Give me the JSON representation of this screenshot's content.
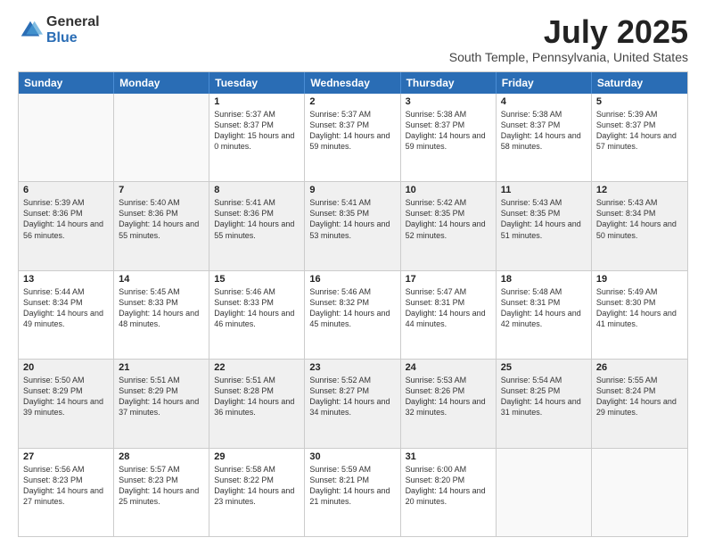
{
  "logo": {
    "general": "General",
    "blue": "Blue"
  },
  "title": "July 2025",
  "subtitle": "South Temple, Pennsylvania, United States",
  "header_days": [
    "Sunday",
    "Monday",
    "Tuesday",
    "Wednesday",
    "Thursday",
    "Friday",
    "Saturday"
  ],
  "weeks": [
    [
      {
        "day": "",
        "sunrise": "",
        "sunset": "",
        "daylight": "",
        "shaded": false,
        "empty": true
      },
      {
        "day": "",
        "sunrise": "",
        "sunset": "",
        "daylight": "",
        "shaded": false,
        "empty": true
      },
      {
        "day": "1",
        "sunrise": "Sunrise: 5:37 AM",
        "sunset": "Sunset: 8:37 PM",
        "daylight": "Daylight: 15 hours and 0 minutes.",
        "shaded": false,
        "empty": false
      },
      {
        "day": "2",
        "sunrise": "Sunrise: 5:37 AM",
        "sunset": "Sunset: 8:37 PM",
        "daylight": "Daylight: 14 hours and 59 minutes.",
        "shaded": false,
        "empty": false
      },
      {
        "day": "3",
        "sunrise": "Sunrise: 5:38 AM",
        "sunset": "Sunset: 8:37 PM",
        "daylight": "Daylight: 14 hours and 59 minutes.",
        "shaded": false,
        "empty": false
      },
      {
        "day": "4",
        "sunrise": "Sunrise: 5:38 AM",
        "sunset": "Sunset: 8:37 PM",
        "daylight": "Daylight: 14 hours and 58 minutes.",
        "shaded": false,
        "empty": false
      },
      {
        "day": "5",
        "sunrise": "Sunrise: 5:39 AM",
        "sunset": "Sunset: 8:37 PM",
        "daylight": "Daylight: 14 hours and 57 minutes.",
        "shaded": false,
        "empty": false
      }
    ],
    [
      {
        "day": "6",
        "sunrise": "Sunrise: 5:39 AM",
        "sunset": "Sunset: 8:36 PM",
        "daylight": "Daylight: 14 hours and 56 minutes.",
        "shaded": true,
        "empty": false
      },
      {
        "day": "7",
        "sunrise": "Sunrise: 5:40 AM",
        "sunset": "Sunset: 8:36 PM",
        "daylight": "Daylight: 14 hours and 55 minutes.",
        "shaded": true,
        "empty": false
      },
      {
        "day": "8",
        "sunrise": "Sunrise: 5:41 AM",
        "sunset": "Sunset: 8:36 PM",
        "daylight": "Daylight: 14 hours and 55 minutes.",
        "shaded": true,
        "empty": false
      },
      {
        "day": "9",
        "sunrise": "Sunrise: 5:41 AM",
        "sunset": "Sunset: 8:35 PM",
        "daylight": "Daylight: 14 hours and 53 minutes.",
        "shaded": true,
        "empty": false
      },
      {
        "day": "10",
        "sunrise": "Sunrise: 5:42 AM",
        "sunset": "Sunset: 8:35 PM",
        "daylight": "Daylight: 14 hours and 52 minutes.",
        "shaded": true,
        "empty": false
      },
      {
        "day": "11",
        "sunrise": "Sunrise: 5:43 AM",
        "sunset": "Sunset: 8:35 PM",
        "daylight": "Daylight: 14 hours and 51 minutes.",
        "shaded": true,
        "empty": false
      },
      {
        "day": "12",
        "sunrise": "Sunrise: 5:43 AM",
        "sunset": "Sunset: 8:34 PM",
        "daylight": "Daylight: 14 hours and 50 minutes.",
        "shaded": true,
        "empty": false
      }
    ],
    [
      {
        "day": "13",
        "sunrise": "Sunrise: 5:44 AM",
        "sunset": "Sunset: 8:34 PM",
        "daylight": "Daylight: 14 hours and 49 minutes.",
        "shaded": false,
        "empty": false
      },
      {
        "day": "14",
        "sunrise": "Sunrise: 5:45 AM",
        "sunset": "Sunset: 8:33 PM",
        "daylight": "Daylight: 14 hours and 48 minutes.",
        "shaded": false,
        "empty": false
      },
      {
        "day": "15",
        "sunrise": "Sunrise: 5:46 AM",
        "sunset": "Sunset: 8:33 PM",
        "daylight": "Daylight: 14 hours and 46 minutes.",
        "shaded": false,
        "empty": false
      },
      {
        "day": "16",
        "sunrise": "Sunrise: 5:46 AM",
        "sunset": "Sunset: 8:32 PM",
        "daylight": "Daylight: 14 hours and 45 minutes.",
        "shaded": false,
        "empty": false
      },
      {
        "day": "17",
        "sunrise": "Sunrise: 5:47 AM",
        "sunset": "Sunset: 8:31 PM",
        "daylight": "Daylight: 14 hours and 44 minutes.",
        "shaded": false,
        "empty": false
      },
      {
        "day": "18",
        "sunrise": "Sunrise: 5:48 AM",
        "sunset": "Sunset: 8:31 PM",
        "daylight": "Daylight: 14 hours and 42 minutes.",
        "shaded": false,
        "empty": false
      },
      {
        "day": "19",
        "sunrise": "Sunrise: 5:49 AM",
        "sunset": "Sunset: 8:30 PM",
        "daylight": "Daylight: 14 hours and 41 minutes.",
        "shaded": false,
        "empty": false
      }
    ],
    [
      {
        "day": "20",
        "sunrise": "Sunrise: 5:50 AM",
        "sunset": "Sunset: 8:29 PM",
        "daylight": "Daylight: 14 hours and 39 minutes.",
        "shaded": true,
        "empty": false
      },
      {
        "day": "21",
        "sunrise": "Sunrise: 5:51 AM",
        "sunset": "Sunset: 8:29 PM",
        "daylight": "Daylight: 14 hours and 37 minutes.",
        "shaded": true,
        "empty": false
      },
      {
        "day": "22",
        "sunrise": "Sunrise: 5:51 AM",
        "sunset": "Sunset: 8:28 PM",
        "daylight": "Daylight: 14 hours and 36 minutes.",
        "shaded": true,
        "empty": false
      },
      {
        "day": "23",
        "sunrise": "Sunrise: 5:52 AM",
        "sunset": "Sunset: 8:27 PM",
        "daylight": "Daylight: 14 hours and 34 minutes.",
        "shaded": true,
        "empty": false
      },
      {
        "day": "24",
        "sunrise": "Sunrise: 5:53 AM",
        "sunset": "Sunset: 8:26 PM",
        "daylight": "Daylight: 14 hours and 32 minutes.",
        "shaded": true,
        "empty": false
      },
      {
        "day": "25",
        "sunrise": "Sunrise: 5:54 AM",
        "sunset": "Sunset: 8:25 PM",
        "daylight": "Daylight: 14 hours and 31 minutes.",
        "shaded": true,
        "empty": false
      },
      {
        "day": "26",
        "sunrise": "Sunrise: 5:55 AM",
        "sunset": "Sunset: 8:24 PM",
        "daylight": "Daylight: 14 hours and 29 minutes.",
        "shaded": true,
        "empty": false
      }
    ],
    [
      {
        "day": "27",
        "sunrise": "Sunrise: 5:56 AM",
        "sunset": "Sunset: 8:23 PM",
        "daylight": "Daylight: 14 hours and 27 minutes.",
        "shaded": false,
        "empty": false
      },
      {
        "day": "28",
        "sunrise": "Sunrise: 5:57 AM",
        "sunset": "Sunset: 8:23 PM",
        "daylight": "Daylight: 14 hours and 25 minutes.",
        "shaded": false,
        "empty": false
      },
      {
        "day": "29",
        "sunrise": "Sunrise: 5:58 AM",
        "sunset": "Sunset: 8:22 PM",
        "daylight": "Daylight: 14 hours and 23 minutes.",
        "shaded": false,
        "empty": false
      },
      {
        "day": "30",
        "sunrise": "Sunrise: 5:59 AM",
        "sunset": "Sunset: 8:21 PM",
        "daylight": "Daylight: 14 hours and 21 minutes.",
        "shaded": false,
        "empty": false
      },
      {
        "day": "31",
        "sunrise": "Sunrise: 6:00 AM",
        "sunset": "Sunset: 8:20 PM",
        "daylight": "Daylight: 14 hours and 20 minutes.",
        "shaded": false,
        "empty": false
      },
      {
        "day": "",
        "sunrise": "",
        "sunset": "",
        "daylight": "",
        "shaded": false,
        "empty": true
      },
      {
        "day": "",
        "sunrise": "",
        "sunset": "",
        "daylight": "",
        "shaded": false,
        "empty": true
      }
    ]
  ]
}
